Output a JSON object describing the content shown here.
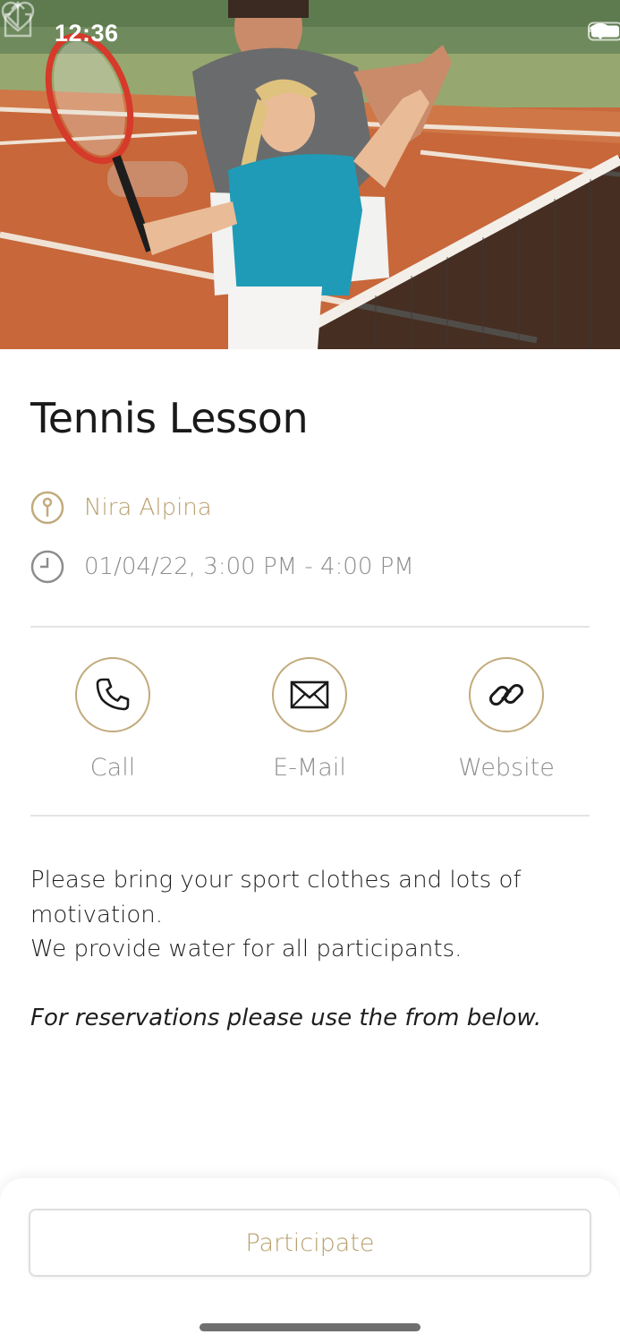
{
  "status_bar": {
    "time": "12:36"
  },
  "event": {
    "title": "Tennis Lesson",
    "location": "Nira Alpina",
    "datetime": "01/04/22, 3:00 PM - 4:00 PM"
  },
  "actions": {
    "call_label": "Call",
    "email_label": "E-Mail",
    "website_label": "Website"
  },
  "description": {
    "line1": "Please bring your sport clothes and lots of motivation.",
    "line2": "We provide water for all participants.",
    "note": "For reservations please use the from below."
  },
  "footer": {
    "participate_label": "Participate"
  },
  "colors": {
    "accent": "#b9a06c",
    "accent_border": "#c2ab7c",
    "muted_text": "#8d8d8d"
  },
  "icons": [
    "back-icon",
    "share-icon",
    "heart-icon",
    "location-pin-icon",
    "clock-icon",
    "phone-icon",
    "envelope-icon",
    "link-icon",
    "wifi-icon",
    "battery-icon",
    "signal-icon"
  ]
}
